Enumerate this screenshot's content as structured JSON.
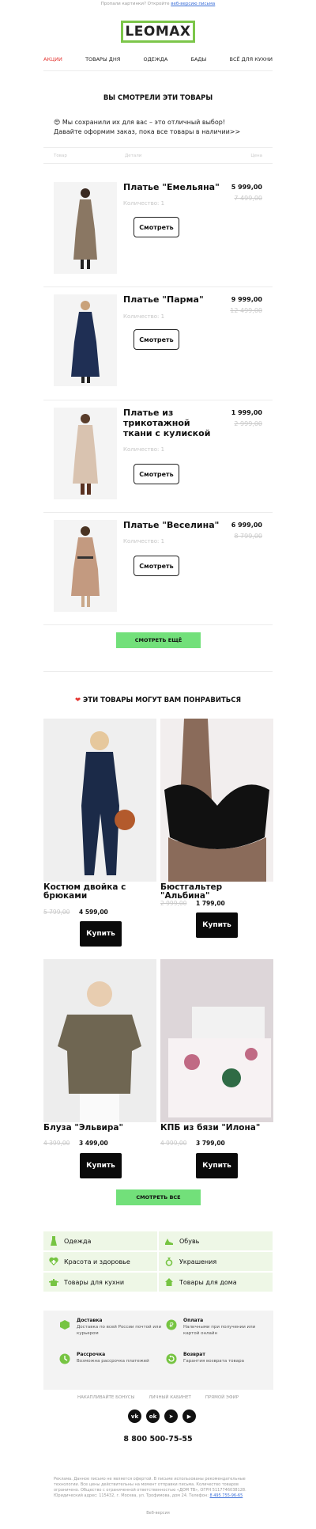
{
  "header": {
    "notice_prefix": "Пропали картинки? Откройте",
    "notice_link": "веб-версию письма",
    "logo_text": "LEOMAX"
  },
  "nav": [
    "АКЦИИ",
    "ТОВАРЫ ДНЯ",
    "ОДЕЖДА",
    "БАДЫ",
    "ВСЁ ДЛЯ КУХНИ"
  ],
  "viewed": {
    "title": "ВЫ СМОТРЕЛИ ЭТИ ТОВАРЫ",
    "lead": "😍 Мы сохранили их для вас – это отличный выбор! Давайте оформим заказ, пока все товары в наличии>>",
    "col_product": "Товар",
    "col_details": "Детали",
    "col_price": "Цена",
    "items": [
      {
        "name": "Платье \"Емельяна\"",
        "qty": "Количество: 1",
        "price": "5 999,00",
        "old_price": "7 499,00",
        "button": "Смотреть"
      },
      {
        "name": "Платье \"Парма\"",
        "qty": "Количество: 1",
        "price": "9 999,00",
        "old_price": "12 499,00",
        "button": "Смотреть"
      },
      {
        "name": "Платье из трикотажной ткани с кулиской",
        "qty": "Количество: 1",
        "price": "1 999,00",
        "old_price": "2 999,00",
        "button": "Смотреть"
      },
      {
        "name": "Платье \"Веселина\"",
        "qty": "Количество: 1",
        "price": "6 999,00",
        "old_price": "8 799,00",
        "button": "Смотреть"
      }
    ],
    "more_button": "СМОТРЕТЬ ЕЩЁ"
  },
  "recommend": {
    "title": "ЭТИ ТОВАРЫ МОГУТ ВАМ ПОНРАВИТЬСЯ",
    "items": [
      {
        "name": "Костюм двойка с брюками",
        "old_price": "5 799,00",
        "price": "4 599,00",
        "button": "Купить"
      },
      {
        "name": "Бюстгальтер \"Альбина\"",
        "old_price": "2 999,00",
        "price": "1 799,00",
        "button": "Купить"
      },
      {
        "name": "Блуза \"Эльвира\"",
        "old_price": "4 399,00",
        "price": "3 499,00",
        "button": "Купить"
      },
      {
        "name": "КПБ из бязи \"Илона\"",
        "old_price": "4 999,00",
        "price": "3 799,00",
        "button": "Купить"
      }
    ],
    "all_button": "СМОТРЕТЬ ВСЕ"
  },
  "categories": [
    "Одежда",
    "Обувь",
    "Красота и здоровье",
    "Украшения",
    "Товары для кухни",
    "Товары для дома"
  ],
  "info": [
    {
      "title": "Доставка",
      "text": "Доставка по всей России почтой или курьером"
    },
    {
      "title": "Оплата",
      "text": "Наличными при получении или картой онлайн"
    },
    {
      "title": "Рассрочка",
      "text": "Возможна рассрочка платежей"
    },
    {
      "title": "Возврат",
      "text": "Гарантия возврата товара"
    }
  ],
  "footer_links": [
    "НАКАПЛИВАЙТЕ БОНУСЫ",
    "ЛИЧНЫЙ КАБИНЕТ",
    "ПРЯМОЙ ЭФИР"
  ],
  "social": [
    "vk",
    "ok",
    "telegram",
    "youtube"
  ],
  "phone": "8 800 500-75-55",
  "legal": "Реклама. Данное письмо не является офертой. В письме использованы рекомендательные технологии. Все цены действительны на момент отправки письма. Количество товаров ограничено. Общество с ограниченной ответственностью «ДОМ ТВ», ОГРН 5117746038128. Юридический адрес: 115432, г. Москва, ул. Трофимова, дом 24. Телефон:",
  "legal_phone": "8 495 755-96-65",
  "web_version": "Веб-версия",
  "colors": {
    "accent_green": "#72e07a",
    "logo_border": "#7cc64a",
    "nav_active": "#e53935"
  }
}
